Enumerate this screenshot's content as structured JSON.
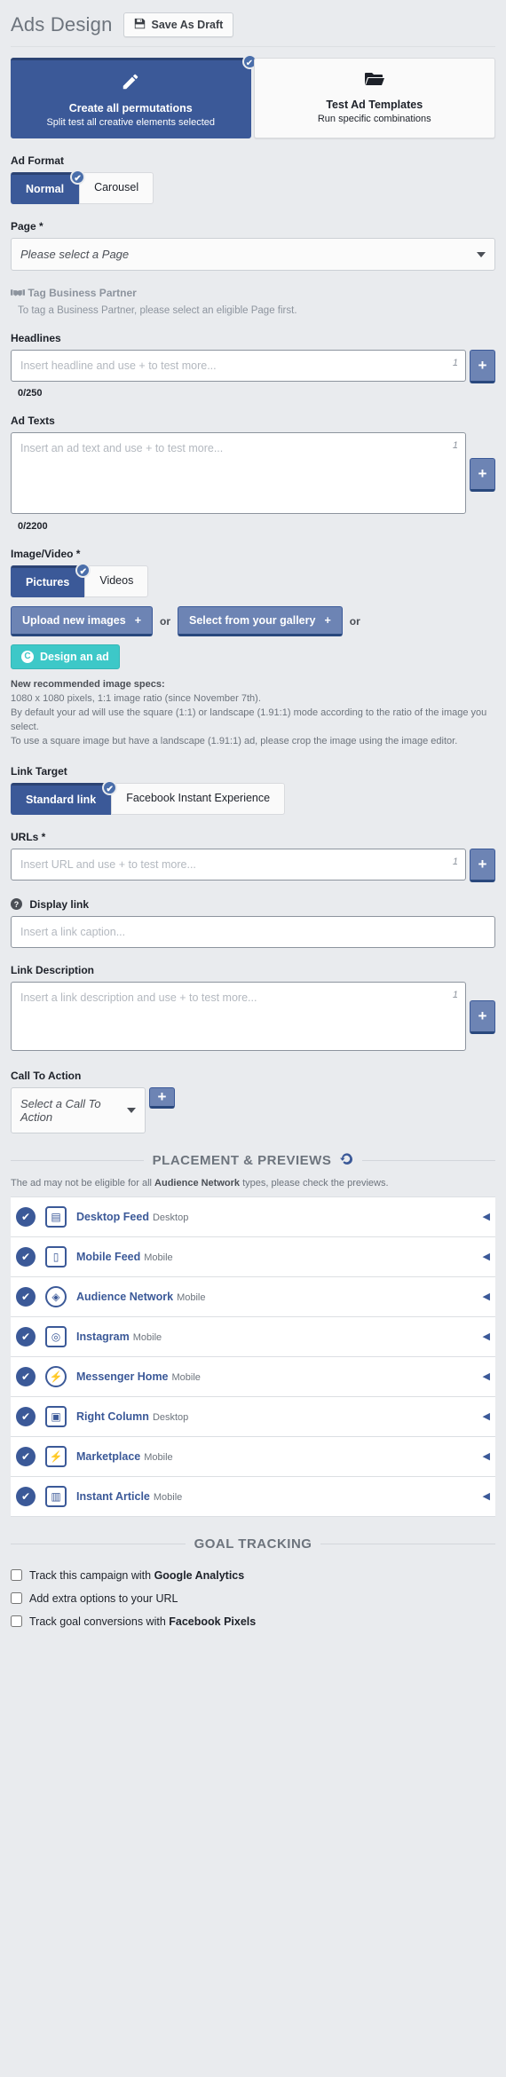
{
  "header": {
    "title": "Ads Design",
    "save_draft_label": "Save As Draft",
    "save_icon": "floppy-disk-icon"
  },
  "modes": [
    {
      "icon": "pencil-icon",
      "title": "Create all permutations",
      "subtitle": "Split test all creative elements selected",
      "selected": true
    },
    {
      "icon": "folder-open-icon",
      "title": "Test Ad Templates",
      "subtitle": "Run specific combinations",
      "selected": false
    }
  ],
  "ad_format": {
    "label": "Ad Format",
    "options": [
      "Normal",
      "Carousel"
    ],
    "selected": "Normal"
  },
  "page_field": {
    "label": "Page *",
    "placeholder": "Please select a Page",
    "value": "Please select a Page"
  },
  "business_partner": {
    "label": "Tag Business Partner",
    "icon": "handshake-icon",
    "hint": "To tag a Business Partner, please select an eligible Page first."
  },
  "headlines": {
    "label": "Headlines",
    "placeholder": "Insert headline and use + to test more...",
    "value": "",
    "index": "1",
    "counter": "0/250",
    "add_label": "+"
  },
  "ad_texts": {
    "label": "Ad Texts",
    "placeholder": "Insert an ad text and use + to test more...",
    "value": "",
    "index": "1",
    "counter": "0/2200",
    "add_label": "+"
  },
  "image_video": {
    "label": "Image/Video *",
    "options": [
      "Pictures",
      "Videos"
    ],
    "selected": "Pictures",
    "upload_label": "Upload new images",
    "gallery_label": "Select from your gallery",
    "or_label": "or",
    "design_label": "Design an ad",
    "design_icon": "canva-circle-icon",
    "specs_title": "New recommended image specs:",
    "specs_lines": [
      "1080 x 1080 pixels, 1:1 image ratio (since November 7th).",
      "By default your ad will use the square (1:1) or landscape (1.91:1) mode according to the ratio of the image you select.",
      "To use a square image but have a landscape (1.91:1) ad, please crop the image using the image editor."
    ]
  },
  "link_target": {
    "label": "Link Target",
    "options": [
      "Standard link",
      "Facebook Instant Experience"
    ],
    "selected": "Standard link"
  },
  "urls": {
    "label": "URLs *",
    "placeholder": "Insert URL and use + to test more...",
    "value": "",
    "index": "1",
    "add_label": "+"
  },
  "display_link": {
    "label": "Display link",
    "icon": "question-circle-icon",
    "placeholder": "Insert a link caption...",
    "value": ""
  },
  "link_description": {
    "label": "Link Description",
    "placeholder": "Insert a link description and use + to test more...",
    "value": "",
    "index": "1",
    "add_label": "+"
  },
  "call_to_action": {
    "label": "Call To Action",
    "placeholder": "Select a Call To Action",
    "value": "Select a Call To Action",
    "add_label": "+"
  },
  "placements_section": {
    "title": "PLACEMENT & PREVIEWS",
    "refresh_icon": "refresh-icon",
    "note_prefix": "The ad may not be eligible for all ",
    "note_bold": "Audience Network",
    "note_suffix": " types, please check the previews.",
    "items": [
      {
        "name": "Desktop Feed",
        "device": "Desktop",
        "icon": "desktop-feed-icon",
        "checked": true
      },
      {
        "name": "Mobile Feed",
        "device": "Mobile",
        "icon": "mobile-feed-icon",
        "checked": true
      },
      {
        "name": "Audience Network",
        "device": "Mobile",
        "icon": "audience-network-icon",
        "checked": true
      },
      {
        "name": "Instagram",
        "device": "Mobile",
        "icon": "instagram-icon",
        "checked": true
      },
      {
        "name": "Messenger Home",
        "device": "Mobile",
        "icon": "messenger-icon",
        "checked": true
      },
      {
        "name": "Right Column",
        "device": "Desktop",
        "icon": "right-column-icon",
        "checked": true
      },
      {
        "name": "Marketplace",
        "device": "Mobile",
        "icon": "marketplace-icon",
        "checked": true
      },
      {
        "name": "Instant Article",
        "device": "Mobile",
        "icon": "instant-article-icon",
        "checked": true
      }
    ]
  },
  "goal_tracking": {
    "title": "GOAL TRACKING",
    "items": [
      {
        "prefix": "Track this campaign with ",
        "bold": "Google Analytics",
        "suffix": "",
        "checked": false
      },
      {
        "prefix": "Add extra options to your URL",
        "bold": "",
        "suffix": "",
        "checked": false
      },
      {
        "prefix": "Track goal conversions with ",
        "bold": "Facebook Pixels",
        "suffix": "",
        "checked": false
      }
    ]
  },
  "colors": {
    "brand_blue": "#3b5998",
    "btn_blue": "#6d84b4",
    "teal": "#3dc8c8",
    "bg": "#e9ebee"
  }
}
